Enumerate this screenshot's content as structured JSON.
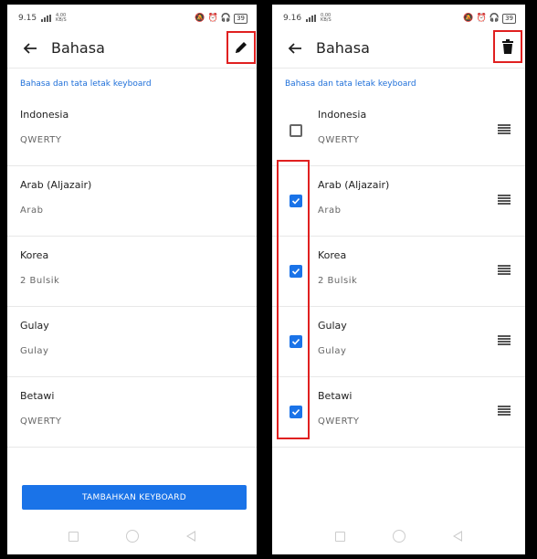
{
  "left": {
    "status": {
      "time": "9.15",
      "net_value": "4,00",
      "net_unit": "KB/S",
      "battery": "39"
    },
    "title": "Bahasa",
    "section_label": "Bahasa dan tata letak keyboard",
    "languages": [
      {
        "name": "Indonesia",
        "layout": "QWERTY"
      },
      {
        "name": "Arab (Aljazair)",
        "layout": "Arab"
      },
      {
        "name": "Korea",
        "layout": "2 Bulsik"
      },
      {
        "name": "Gulay",
        "layout": "Gulay"
      },
      {
        "name": "Betawi",
        "layout": "QWERTY"
      }
    ],
    "add_keyboard_label": "TAMBAHKAN KEYBOARD"
  },
  "right": {
    "status": {
      "time": "9.16",
      "net_value": "0,00",
      "net_unit": "KB/S",
      "battery": "39"
    },
    "title": "Bahasa",
    "section_label": "Bahasa dan tata letak keyboard",
    "languages": [
      {
        "name": "Indonesia",
        "layout": "QWERTY",
        "checked": false
      },
      {
        "name": "Arab (Aljazair)",
        "layout": "Arab",
        "checked": true
      },
      {
        "name": "Korea",
        "layout": "2 Bulsik",
        "checked": true
      },
      {
        "name": "Gulay",
        "layout": "Gulay",
        "checked": true
      },
      {
        "name": "Betawi",
        "layout": "QWERTY",
        "checked": true
      }
    ]
  },
  "colors": {
    "accent": "#1a73e8",
    "highlight": "#e02020",
    "section_label": "#1e6fd9"
  },
  "icons": {
    "left_action": "pencil-icon",
    "right_action": "trash-icon",
    "back": "arrow-left-icon",
    "drag": "drag-handle-icon"
  }
}
